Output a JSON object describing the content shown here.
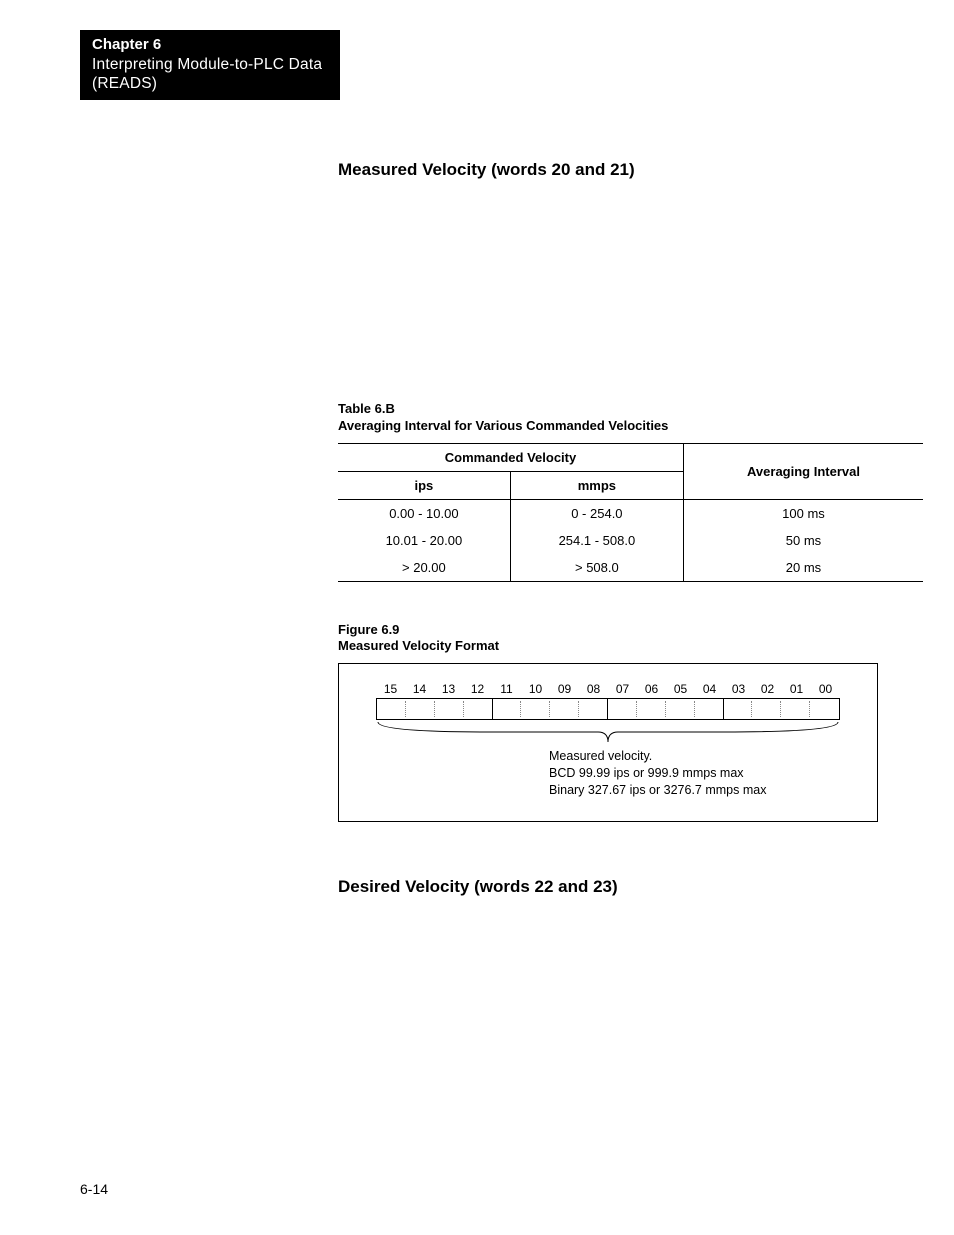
{
  "chapter": {
    "label": "Chapter 6",
    "title_line1": "Interpreting Module-to-PLC Data",
    "title_line2": "(READS)"
  },
  "section1": {
    "title": "Measured Velocity (words 20 and 21)"
  },
  "table": {
    "caption_line1": "Table 6.B",
    "caption_line2": "Averaging Interval for Various Commanded Velocities",
    "header_group": "Commanded Velocity",
    "header_right": "Averaging Interval",
    "sub1": "ips",
    "sub2": "mmps",
    "rows": [
      {
        "ips": "0.00 - 10.00",
        "mmps": "0  - 254.0",
        "interval": "100 ms"
      },
      {
        "ips": "10.01 - 20.00",
        "mmps": "254.1 - 508.0",
        "interval": "50 ms"
      },
      {
        "ips": "> 20.00",
        "mmps": "> 508.0",
        "interval": "20 ms"
      }
    ]
  },
  "figure": {
    "caption_line1": "Figure 6.9",
    "caption_line2": "Measured Velocity Format",
    "bits": [
      "15",
      "14",
      "13",
      "12",
      "11",
      "10",
      "09",
      "08",
      "07",
      "06",
      "05",
      "04",
      "03",
      "02",
      "01",
      "00"
    ],
    "note_line1": "Measured velocity.",
    "note_line2": "BCD 99.99 ips or 999.9 mmps max",
    "note_line3": "Binary 327.67 ips or 3276.7 mmps max"
  },
  "section2": {
    "title": "Desired Velocity (words 22 and 23)"
  },
  "page_number": "6-14"
}
